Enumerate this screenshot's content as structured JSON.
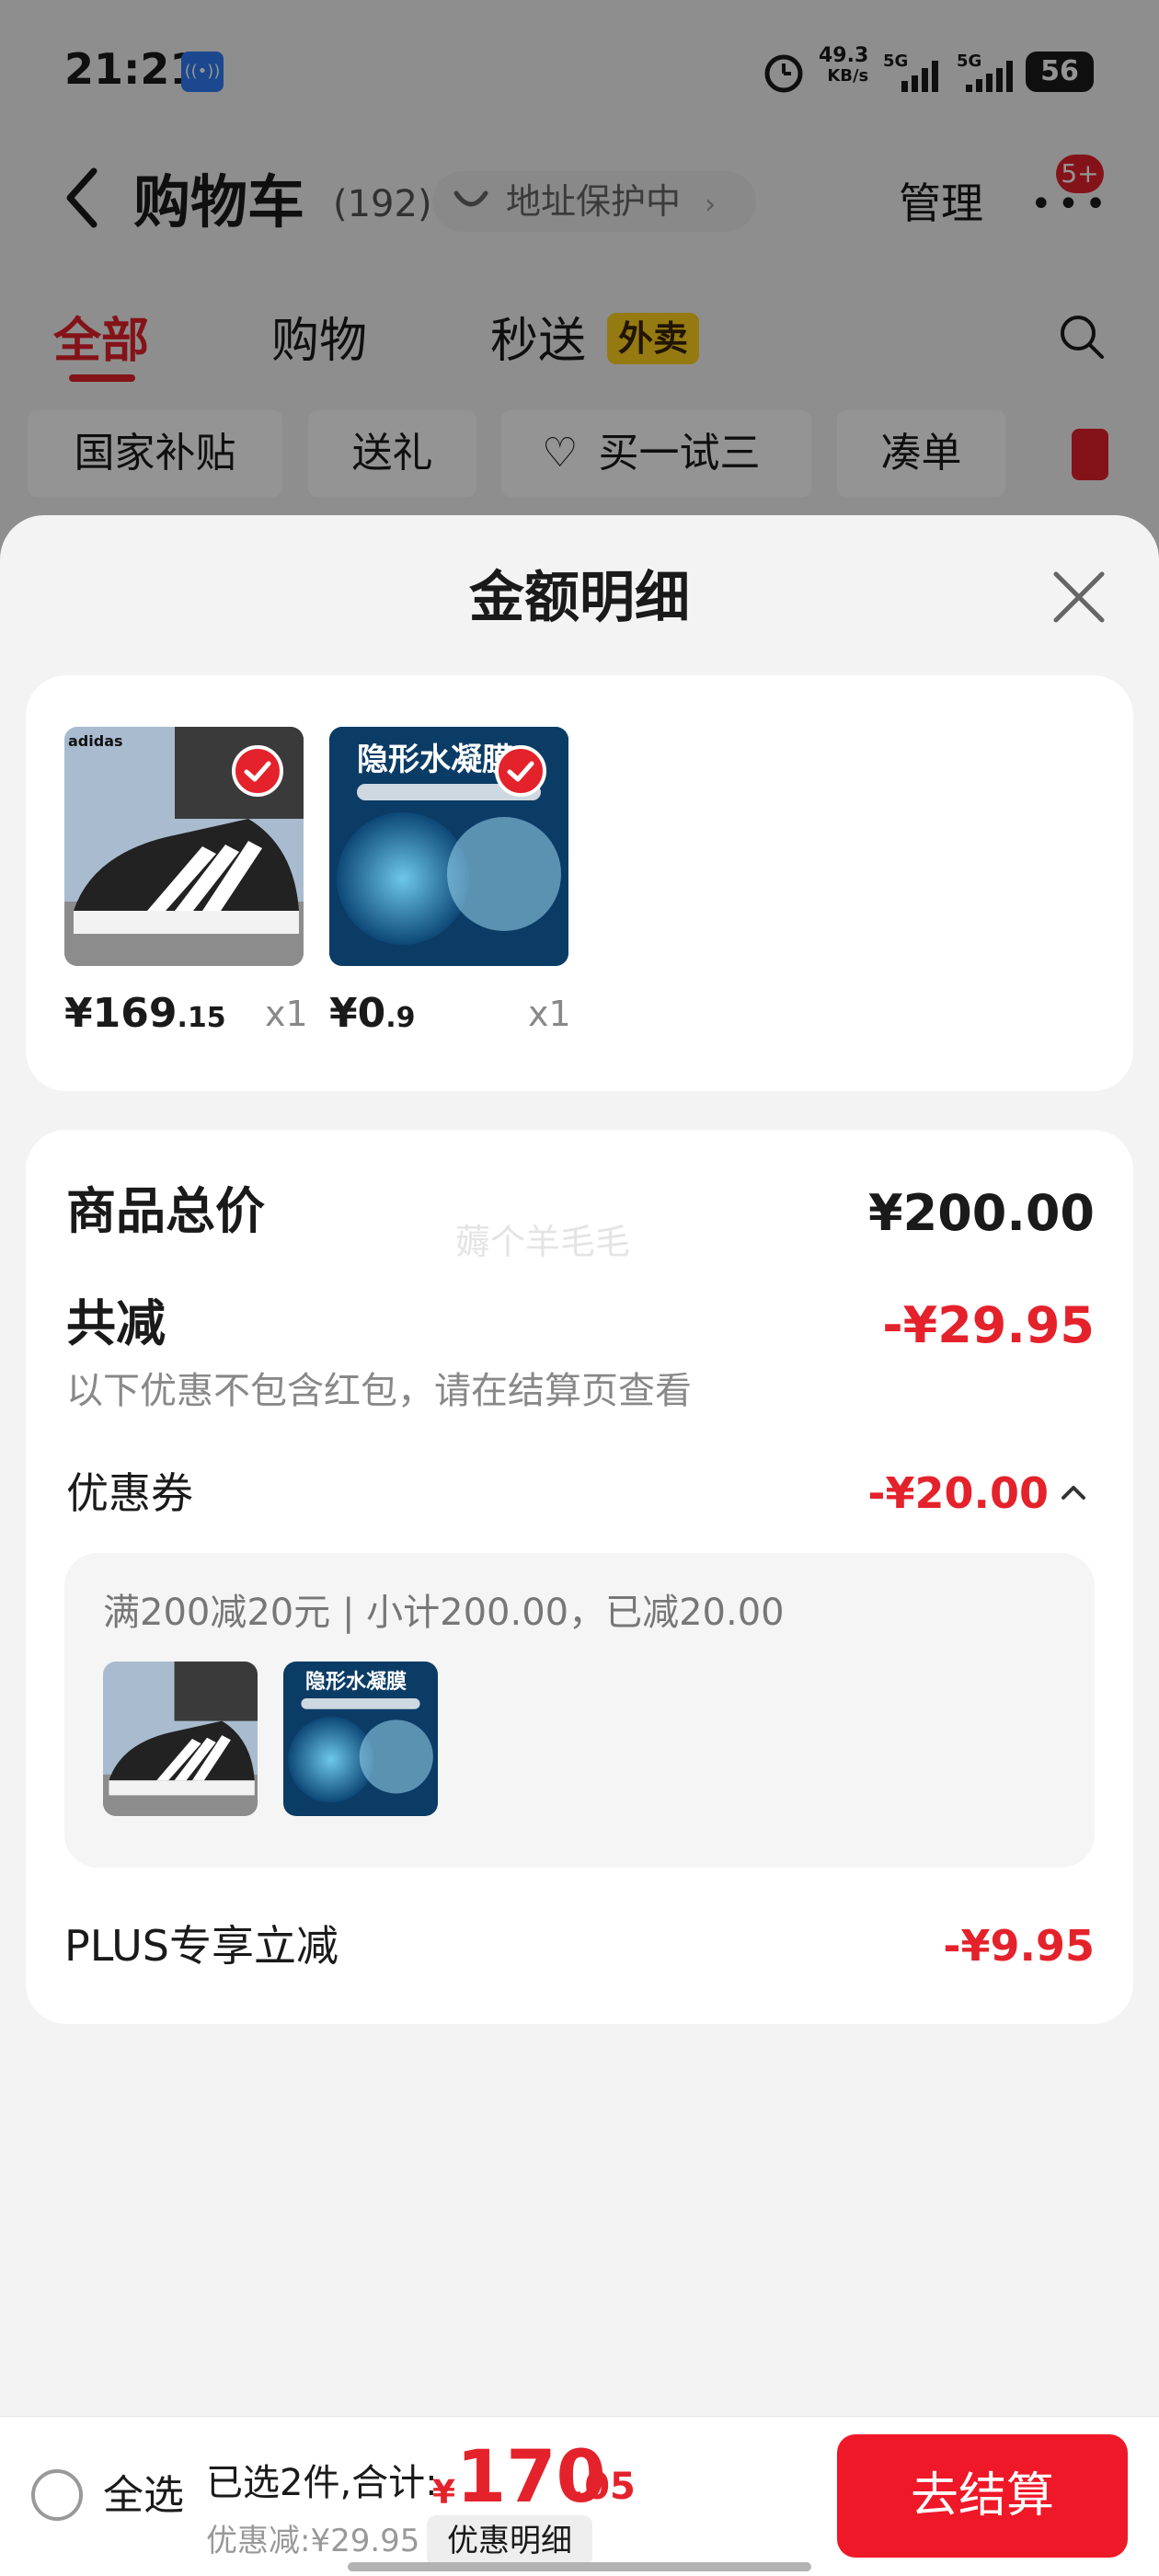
{
  "status_bar": {
    "time": "21:21",
    "net_speed_value": "49.3",
    "net_speed_unit": "KB/s",
    "sim1": "5G",
    "sim2": "5G",
    "battery": "56"
  },
  "header": {
    "title": "购物车",
    "count": "(192)",
    "address_protection": "地址保护中",
    "manage": "管理",
    "message_badge": "5+"
  },
  "tabs": [
    {
      "label": "全部"
    },
    {
      "label": "购物"
    },
    {
      "label": "秒送"
    }
  ],
  "tab_tag": "外卖",
  "chips": [
    {
      "label": "国家补贴"
    },
    {
      "label": "送礼"
    },
    {
      "label": "买一试三"
    },
    {
      "label": "凑单"
    }
  ],
  "sheet": {
    "title": "金额明细"
  },
  "products": [
    {
      "name": "adidas sneaker",
      "brand_text": "adidas",
      "price_int": "¥169",
      "price_dec": ".15",
      "qty": "x1"
    },
    {
      "name": "隐形水凝膜",
      "brand_text": "隐形水凝膜",
      "price_int": "¥0",
      "price_dec": ".9",
      "qty": "x1"
    }
  ],
  "summary": {
    "total_label": "商品总价",
    "total_value": "¥200.00",
    "watermark": "薅个羊毛毛",
    "reduce_label": "共减",
    "reduce_value": "-¥29.95",
    "note": "以下优惠不包含红包，请在结算页查看",
    "coupon_label": "优惠券",
    "coupon_value": "-¥20.00",
    "coupon_detail": "满200减20元 | 小计200.00，已减20.00",
    "plus_label": "PLUS专享立减",
    "plus_value": "-¥9.95"
  },
  "bottom": {
    "select_all": "全选",
    "selected_info": "已选2件,合计:",
    "total_yen": "¥",
    "total_int": "170",
    "total_dec": ".05",
    "discount": "优惠减:¥29.95",
    "detail_button": "优惠明细",
    "checkout": "去结算"
  },
  "colors": {
    "accent_red": "#e4222b",
    "checkout_red": "#ef1828",
    "tag_yellow": "#ffd21e"
  }
}
